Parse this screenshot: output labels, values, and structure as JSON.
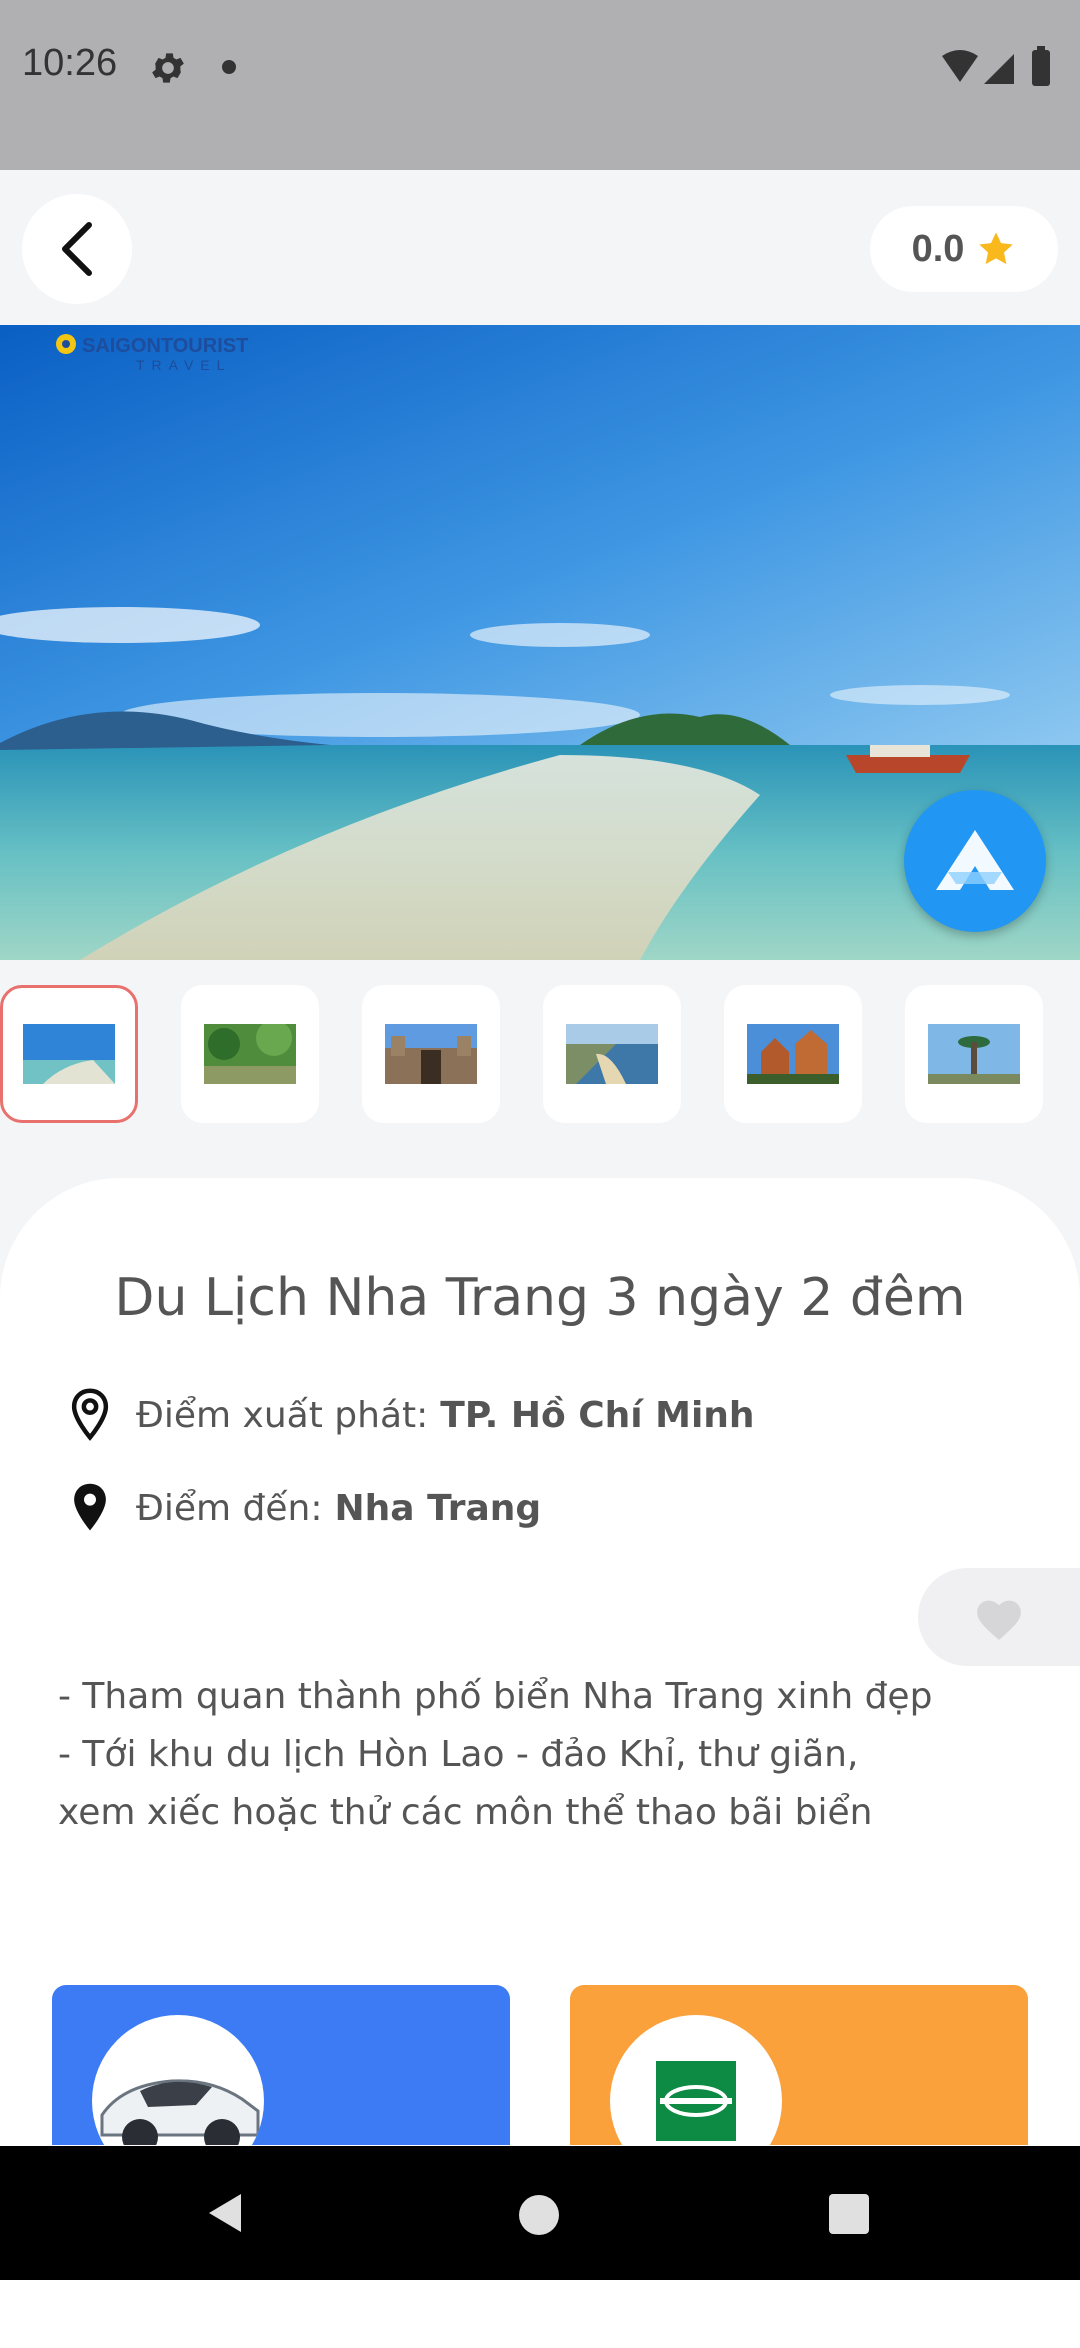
{
  "status_bar": {
    "time": "10:26"
  },
  "header": {
    "rating": "0.0"
  },
  "hero": {
    "brand_main": "SAIGONTOURIST",
    "brand_sub": "TRAVEL"
  },
  "tour": {
    "title": "Du Lịch Nha Trang 3 ngày 2 đêm",
    "departure_label": "Điểm xuất phát:",
    "departure_value": "TP. Hồ Chí Minh",
    "destination_label": "Điểm đến:",
    "destination_value": "Nha Trang",
    "description_line1": "- Tham quan thành phố biển Nha Trang xinh đẹp",
    "description_line2": "- Tới khu du lịch Hòn Lao - đảo Khỉ, thư giãn, xem xiếc hoặc thử các môn thể thao bãi biển"
  },
  "colors": {
    "accent_blue": "#2196f3",
    "card_blue": "#3d7bf5",
    "card_orange": "#fba13c",
    "star": "#f9b81b",
    "active_border": "#e8706d"
  },
  "icons": [
    "back-arrow-icon",
    "star-icon",
    "location-outline-icon",
    "location-filled-icon",
    "heart-icon",
    "app-logo-icon",
    "gear-icon",
    "car-icon",
    "enterprise-logo-icon"
  ]
}
